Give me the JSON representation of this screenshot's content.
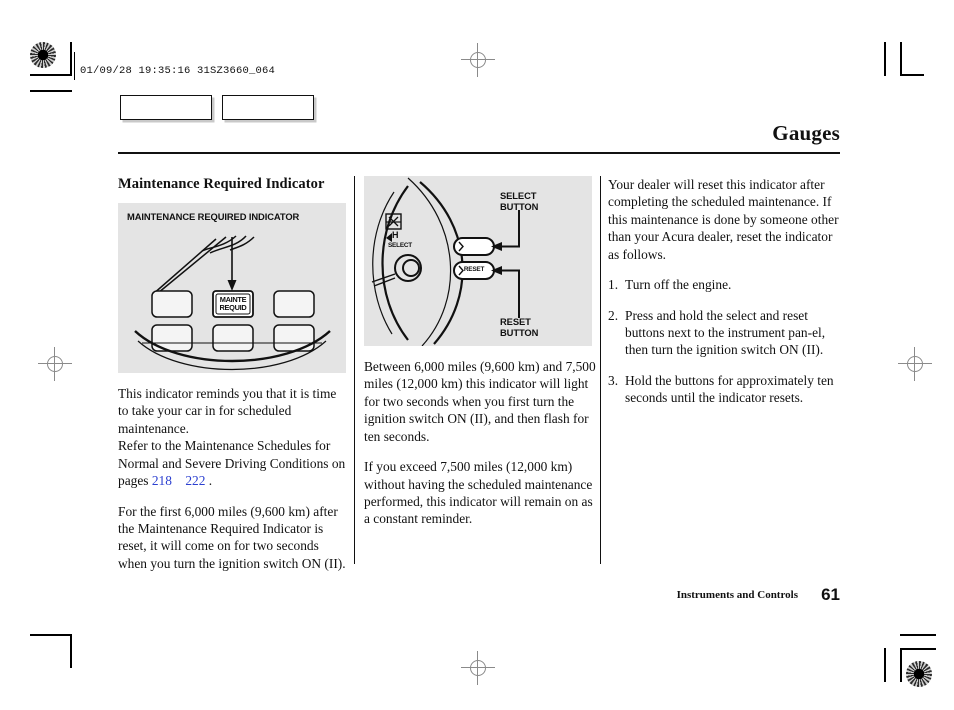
{
  "print_marks": {
    "header_code": "01/09/28 19:35:16 31SZ3660_064"
  },
  "header": {
    "title": "Gauges",
    "tab_1_label": "",
    "tab_2_label": ""
  },
  "columns": {
    "left": {
      "section_heading": "Maintenance Required Indicator",
      "figure": {
        "caption": "MAINTENANCE REQUIRED INDICATOR",
        "indicator_line_1": "MAINTE",
        "indicator_line_2": "REQUID"
      },
      "paragraphs": [
        {
          "id": "p1",
          "text_before": "This indicator reminds you that it is time to take your car in for scheduled maintenance.\nRefer to the Maintenance Schedules for Normal and Severe Driving Conditions on pages ",
          "ref_1": "218",
          "ref_2": "222",
          "text_after": " ."
        },
        {
          "id": "p2",
          "text": "For the first 6,000 miles (9,600 km) after the Maintenance Required Indicator is reset, it will come on for two seconds when you turn the ignition switch ON (II)."
        }
      ]
    },
    "middle": {
      "figure": {
        "select_label": "SELECT\nBUTTON",
        "reset_label": "RESET\nBUTTON",
        "select_button_text": "SELECT",
        "reset_button_text": "RESET",
        "gauge_icon_label": "H"
      },
      "paragraphs": [
        {
          "id": "p1",
          "text": "Between 6,000 miles (9,600 km) and 7,500 miles (12,000 km) this indicator will light for two seconds when you first turn the ignition switch ON (II), and then flash for ten seconds."
        },
        {
          "id": "p2",
          "text": "If you exceed 7,500 miles (12,000 km) without having the scheduled maintenance performed, this indicator will remain on as a constant reminder."
        }
      ]
    },
    "right": {
      "intro": "Your dealer will reset this indicator after completing the scheduled maintenance. If this maintenance is done by someone other than your Acura dealer, reset the indicator as follows.",
      "steps": [
        {
          "num": "1.",
          "text": "Turn off the engine."
        },
        {
          "num": "2.",
          "text": "Press and hold the select and reset buttons next to the instrument pan-el, then turn the ignition switch ON (II)."
        },
        {
          "num": "3.",
          "text": "Hold the buttons for approximately ten seconds until the indicator resets."
        }
      ]
    }
  },
  "footer": {
    "chapter": "Instruments and Controls",
    "page_number": "61"
  },
  "colors": {
    "text": "#111111",
    "page_reference_link": "#2b3fd0",
    "figure_background": "#e4e4e4",
    "registration_mark": "#8a8a8a"
  }
}
